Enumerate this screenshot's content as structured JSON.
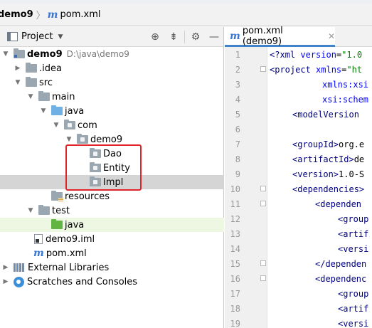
{
  "breadcrumb": {
    "project": "demo9",
    "file": "pom.xml"
  },
  "project_panel": {
    "title": "Project",
    "rows": [
      {
        "label": "demo9",
        "path": "D:\\java\\demo9"
      },
      {
        "label": ".idea"
      },
      {
        "label": "src"
      },
      {
        "label": "main"
      },
      {
        "label": "java"
      },
      {
        "label": "com"
      },
      {
        "label": "demo9"
      },
      {
        "label": "Dao"
      },
      {
        "label": "Entity"
      },
      {
        "label": "Impl"
      },
      {
        "label": "resources"
      },
      {
        "label": "test"
      },
      {
        "label": "java"
      },
      {
        "label": "demo9.iml"
      },
      {
        "label": "pom.xml"
      },
      {
        "label": "External Libraries"
      },
      {
        "label": "Scratches and Consoles"
      }
    ]
  },
  "editor": {
    "tab_label": "pom.xml (demo9)",
    "lines": [
      {
        "n": "1",
        "parts": [
          [
            "decl",
            "<?xml "
          ],
          [
            "attr",
            "version"
          ],
          [
            "plain",
            "="
          ],
          [
            "val",
            "\"1.0"
          ]
        ]
      },
      {
        "n": "2",
        "parts": [
          [
            "tag",
            "<project "
          ],
          [
            "attr",
            "xmlns"
          ],
          [
            "plain",
            "="
          ],
          [
            "val",
            "\"ht"
          ]
        ]
      },
      {
        "n": "3",
        "parts": [
          [
            "attr",
            "xmlns:xsi"
          ]
        ]
      },
      {
        "n": "4",
        "parts": [
          [
            "attr",
            "xsi:schem"
          ]
        ]
      },
      {
        "n": "5",
        "parts": [
          [
            "tag",
            "<modelVersion"
          ]
        ]
      },
      {
        "n": "6",
        "parts": []
      },
      {
        "n": "7",
        "parts": [
          [
            "tag",
            "<groupId>"
          ],
          [
            "plain",
            "org.e"
          ]
        ]
      },
      {
        "n": "8",
        "parts": [
          [
            "tag",
            "<artifactId>"
          ],
          [
            "plain",
            "de"
          ]
        ]
      },
      {
        "n": "9",
        "parts": [
          [
            "tag",
            "<version>"
          ],
          [
            "plain",
            "1.0-S"
          ]
        ]
      },
      {
        "n": "10",
        "parts": [
          [
            "tag",
            "<dependencies>"
          ]
        ]
      },
      {
        "n": "11",
        "parts": [
          [
            "tag",
            "<dependen"
          ]
        ]
      },
      {
        "n": "12",
        "parts": [
          [
            "tag",
            "<group"
          ]
        ]
      },
      {
        "n": "13",
        "parts": [
          [
            "tag",
            "<artif"
          ]
        ]
      },
      {
        "n": "14",
        "parts": [
          [
            "tag",
            "<versi"
          ]
        ]
      },
      {
        "n": "15",
        "parts": [
          [
            "tag",
            "</dependen"
          ]
        ]
      },
      {
        "n": "16",
        "parts": [
          [
            "tag",
            "<dependenc"
          ]
        ]
      },
      {
        "n": "17",
        "parts": [
          [
            "tag",
            "<group"
          ]
        ]
      },
      {
        "n": "18",
        "parts": [
          [
            "tag",
            "<artif"
          ]
        ]
      },
      {
        "n": "19",
        "parts": [
          [
            "tag",
            "<versi"
          ]
        ]
      }
    ]
  }
}
